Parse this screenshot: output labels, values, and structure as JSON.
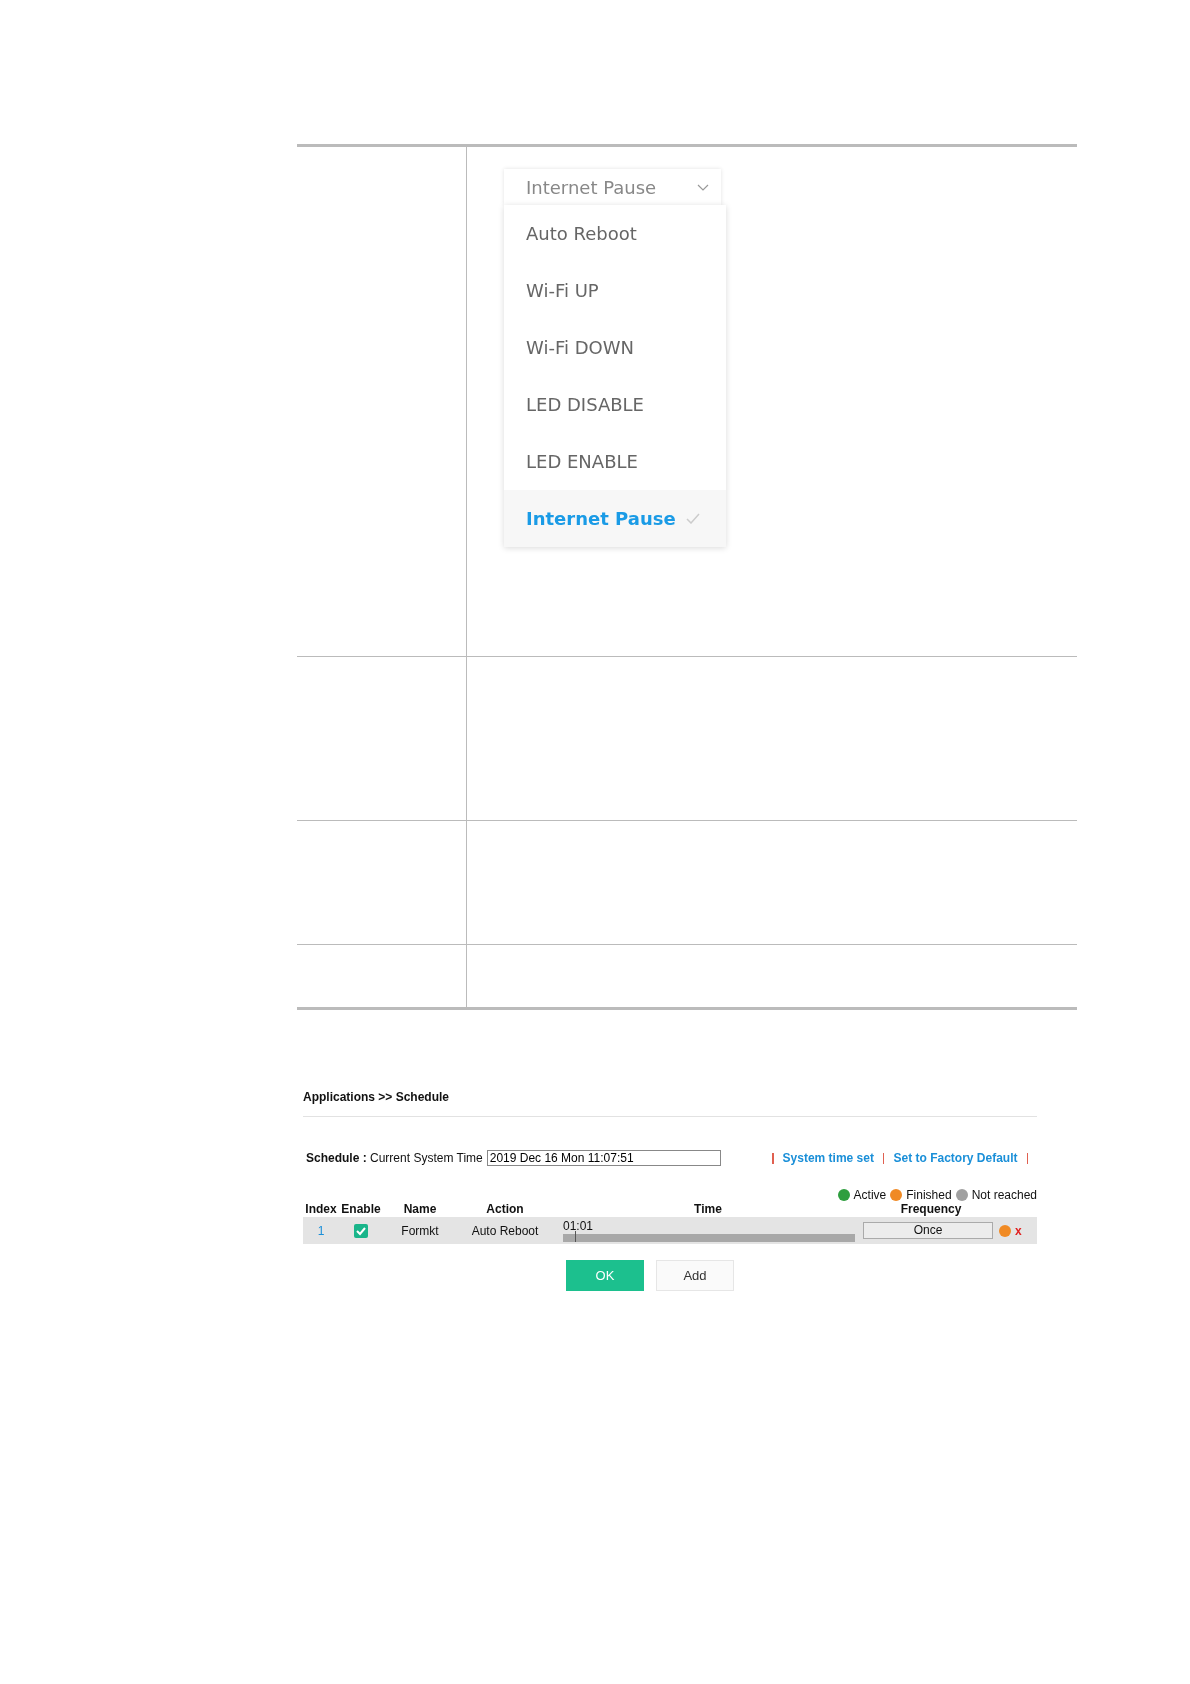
{
  "dropdown": {
    "value": "Internet Pause",
    "options": [
      {
        "label": "Auto Reboot",
        "selected": false
      },
      {
        "label": "Wi-Fi UP",
        "selected": false
      },
      {
        "label": "Wi-Fi DOWN",
        "selected": false
      },
      {
        "label": "LED DISABLE",
        "selected": false
      },
      {
        "label": "LED ENABLE",
        "selected": false
      },
      {
        "label": "Internet Pause",
        "selected": true
      }
    ]
  },
  "schedule_panel": {
    "breadcrumb": "Applications >> Schedule",
    "schedule_label": "Schedule :",
    "time_label": "Current System Time",
    "time_value": "2019 Dec 16 Mon 11:07:51",
    "links": [
      "System time set",
      "Set to Factory Default"
    ],
    "legend": [
      {
        "label": "Active",
        "color": "#2e9e3e"
      },
      {
        "label": "Finished",
        "color": "#f08a24"
      },
      {
        "label": "Not reached",
        "color": "#a0a0a0"
      }
    ],
    "columns": [
      "Index",
      "Enable",
      "Name",
      "Action",
      "Time",
      "Frequency"
    ],
    "rows": [
      {
        "index": "1",
        "checked": true,
        "name": "Formkt",
        "action": "Auto Reboot",
        "time": "01:01",
        "frequency": "Once",
        "color": "#f08a24",
        "delete": "x"
      }
    ],
    "buttons": [
      {
        "label": "OK",
        "kind": "primary"
      },
      {
        "label": "Add",
        "kind": "secondary"
      }
    ]
  }
}
